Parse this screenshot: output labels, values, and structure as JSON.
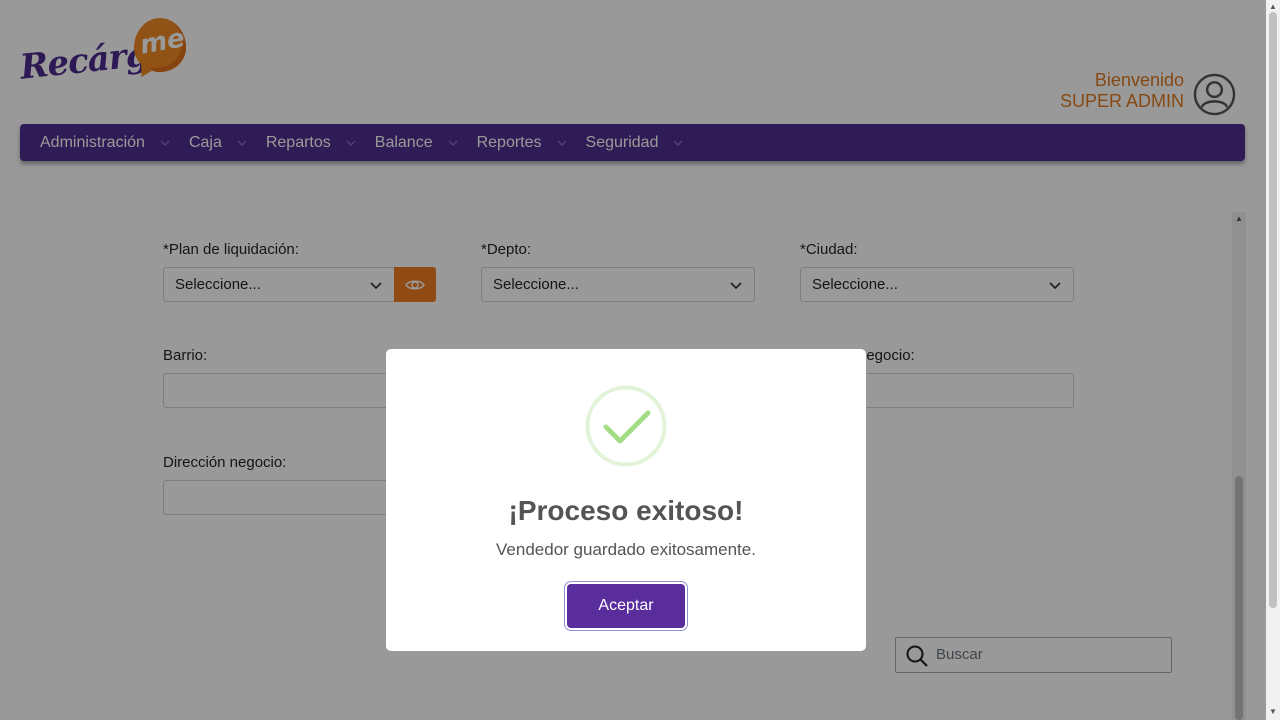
{
  "header": {
    "logo_text": "Recárga",
    "logo_bubble_text": "me",
    "welcome_line1": "Bienvenido",
    "welcome_line2": "SUPER ADMIN"
  },
  "nav": {
    "items": [
      {
        "label": "Administración"
      },
      {
        "label": "Caja"
      },
      {
        "label": "Repartos"
      },
      {
        "label": "Balance"
      },
      {
        "label": "Reportes"
      },
      {
        "label": "Seguridad"
      }
    ]
  },
  "form": {
    "plan_label": "*Plan de liquidación:",
    "plan_value": "Seleccione...",
    "depto_label": "*Depto:",
    "depto_value": "Seleccione...",
    "ciudad_label": "*Ciudad:",
    "ciudad_value": "Seleccione...",
    "barrio_label": "Barrio:",
    "negocio_label_partial": "negocio:",
    "direccion_label": "Dirección negocio:",
    "search_placeholder": "Buscar"
  },
  "modal": {
    "title": "¡Proceso exitoso!",
    "message": "Vendedor guardado exitosamente.",
    "accept_label": "Aceptar"
  },
  "colors": {
    "brand_purple": "#4f2d8f",
    "brand_orange": "#f07c22",
    "success_green": "#a5dc86"
  }
}
